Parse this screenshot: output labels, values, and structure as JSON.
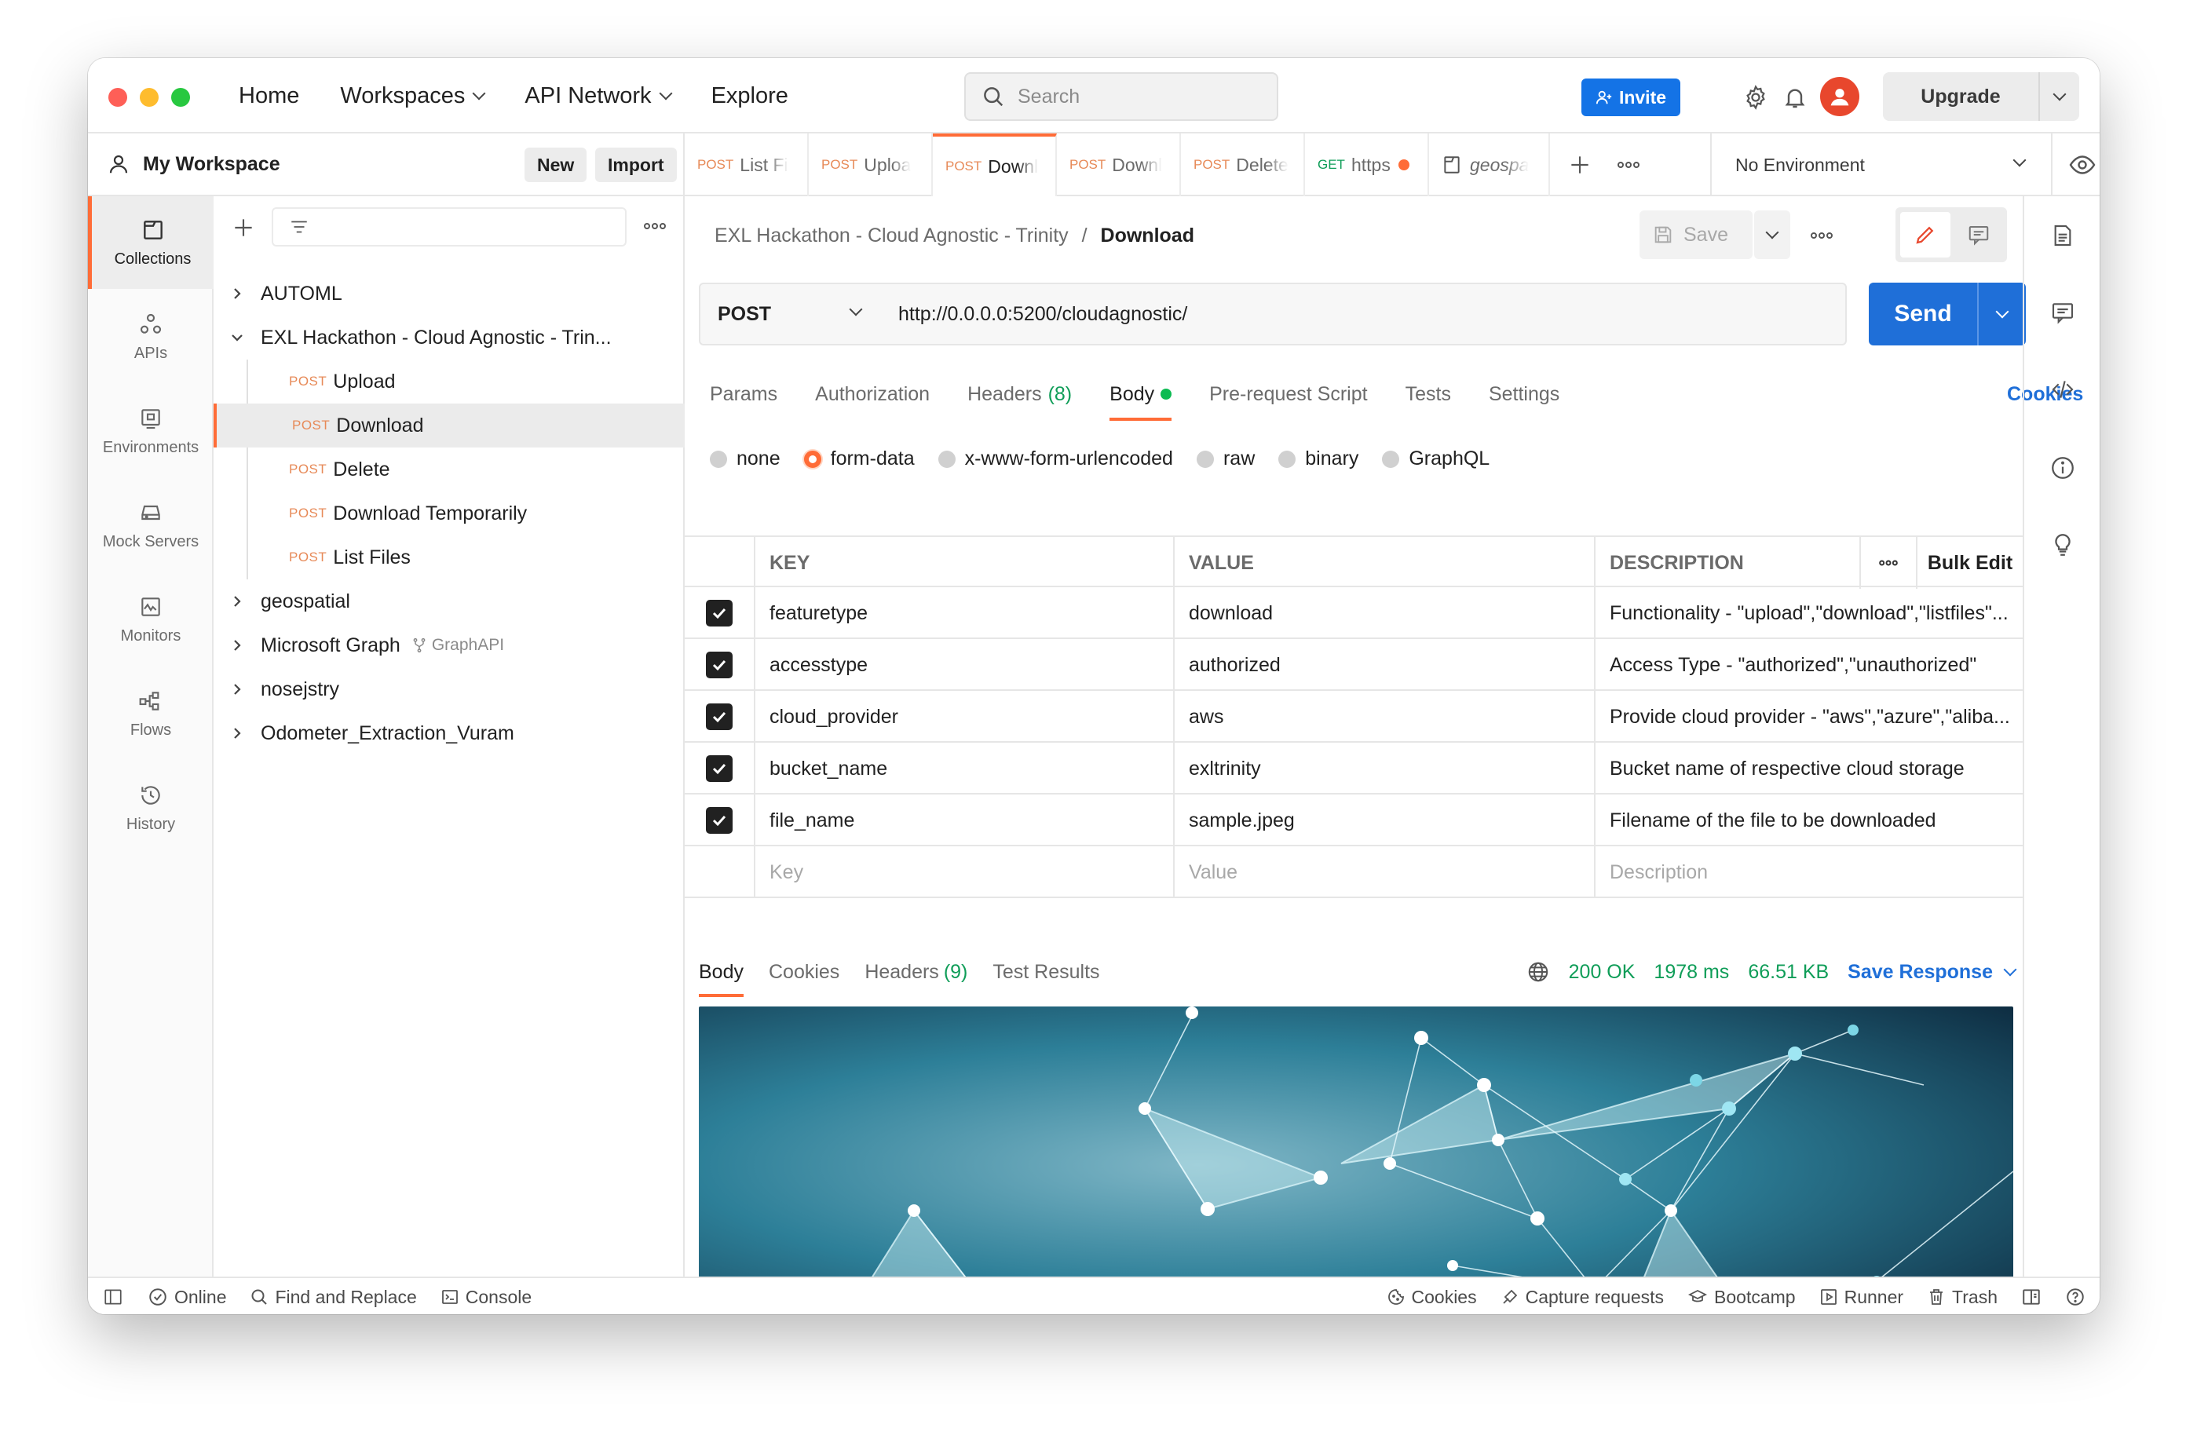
{
  "topnav": {
    "home": "Home",
    "workspaces": "Workspaces",
    "api_network": "API Network",
    "explore": "Explore",
    "search_placeholder": "Search",
    "invite": "Invite",
    "upgrade": "Upgrade"
  },
  "workspace": {
    "title": "My Workspace",
    "new_label": "New",
    "import_label": "Import"
  },
  "rail": {
    "items": [
      {
        "label": "Collections",
        "icon": "collections-icon"
      },
      {
        "label": "APIs",
        "icon": "apis-icon"
      },
      {
        "label": "Environments",
        "icon": "environments-icon"
      },
      {
        "label": "Mock Servers",
        "icon": "mock-servers-icon"
      },
      {
        "label": "Monitors",
        "icon": "monitors-icon"
      },
      {
        "label": "Flows",
        "icon": "flows-icon"
      },
      {
        "label": "History",
        "icon": "history-icon"
      }
    ]
  },
  "tree": {
    "automl": "AUTOML",
    "exl": "EXL Hackathon - Cloud Agnostic - Trin...",
    "requests": [
      {
        "method": "POST",
        "name": "Upload"
      },
      {
        "method": "POST",
        "name": "Download"
      },
      {
        "method": "POST",
        "name": "Delete"
      },
      {
        "method": "POST",
        "name": "Download Temporarily"
      },
      {
        "method": "POST",
        "name": "List Files"
      }
    ],
    "geospatial": "geospatial",
    "msgraph": "Microsoft Graph",
    "msgraph_sub": "GraphAPI",
    "nosejstry": "nosejstry",
    "odometer": "Odometer_Extraction_Vuram"
  },
  "tabs": [
    {
      "method": "POST",
      "name": "List Fi"
    },
    {
      "method": "POST",
      "name": "Uploa"
    },
    {
      "method": "POST",
      "name": "Downl"
    },
    {
      "method": "POST",
      "name": "Downl"
    },
    {
      "method": "POST",
      "name": "Delete"
    },
    {
      "method": "GET",
      "name": "https"
    },
    {
      "method": "",
      "name": "geospa"
    }
  ],
  "environment": "No Environment",
  "breadcrumb": {
    "collection": "EXL Hackathon - Cloud Agnostic - Trinity",
    "sep": "/",
    "current": "Download"
  },
  "save_label": "Save",
  "request": {
    "method": "POST",
    "url": "http://0.0.0.0:5200/cloudagnostic/",
    "send": "Send"
  },
  "req_tabs": {
    "params": "Params",
    "authorization": "Authorization",
    "headers": "Headers",
    "headers_count": "(8)",
    "body": "Body",
    "prerequest": "Pre-request Script",
    "tests": "Tests",
    "settings": "Settings",
    "cookies": "Cookies"
  },
  "body_types": [
    "none",
    "form-data",
    "x-www-form-urlencoded",
    "raw",
    "binary",
    "GraphQL"
  ],
  "form": {
    "headers": {
      "key": "KEY",
      "value": "VALUE",
      "description": "DESCRIPTION",
      "bulk_edit": "Bulk Edit"
    },
    "rows": [
      {
        "key": "featuretype",
        "value": "download",
        "description": "Functionality - \"upload\",\"download\",\"listfiles\"..."
      },
      {
        "key": "accesstype",
        "value": "authorized",
        "description": "Access Type - \"authorized\",\"unauthorized\""
      },
      {
        "key": "cloud_provider",
        "value": "aws",
        "description": "Provide cloud provider - \"aws\",\"azure\",\"aliba..."
      },
      {
        "key": "bucket_name",
        "value": "exltrinity",
        "description": "Bucket name of respective cloud storage"
      },
      {
        "key": "file_name",
        "value": "sample.jpeg",
        "description": "Filename of the file to be downloaded"
      }
    ],
    "placeholders": {
      "key": "Key",
      "value": "Value",
      "description": "Description"
    }
  },
  "response": {
    "body": "Body",
    "cookies": "Cookies",
    "headers": "Headers",
    "headers_count": "(9)",
    "test_results": "Test Results",
    "status": "200 OK",
    "time": "1978 ms",
    "size": "66.51 KB",
    "save_response": "Save Response"
  },
  "statusbar": {
    "online": "Online",
    "find_replace": "Find and Replace",
    "console": "Console",
    "cookies": "Cookies",
    "capture": "Capture requests",
    "bootcamp": "Bootcamp",
    "runner": "Runner",
    "trash": "Trash"
  },
  "colors": {
    "accent": "#ff6c37",
    "primary": "#1f6fd8",
    "success": "#0f9d58"
  }
}
